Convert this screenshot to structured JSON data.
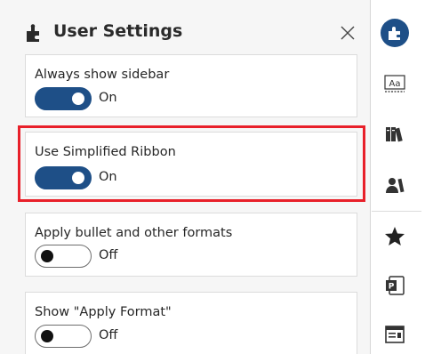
{
  "panel": {
    "title": "User Settings",
    "close_icon": "close-icon",
    "logo_icon": "puzzle-piece-icon"
  },
  "settings": [
    {
      "label": "Always show sidebar",
      "state": "On",
      "enabled": true
    },
    {
      "label": "Use Simplified Ribbon",
      "state": "On",
      "enabled": true
    },
    {
      "label": "Apply bullet and other formats",
      "state": "Off",
      "enabled": false
    },
    {
      "label": "Show \"Apply Format\"",
      "state": "Off",
      "enabled": false
    }
  ],
  "rail": {
    "icons": [
      "add-in-logo-icon",
      "text-style-icon",
      "library-books-icon",
      "users-icon",
      "favorite-star-icon",
      "powerpoint-icon",
      "window-layout-icon"
    ]
  },
  "colors": {
    "toggle_on": "#1e4f87",
    "highlight": "#e8202a"
  }
}
